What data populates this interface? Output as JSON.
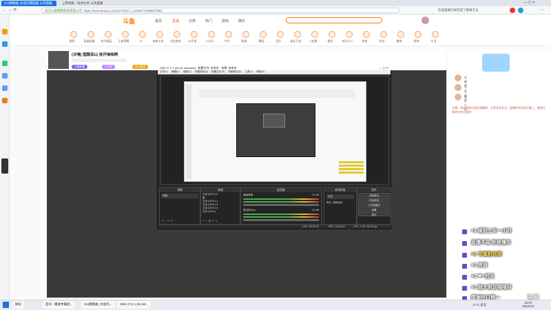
{
  "browser": {
    "tabs": [
      {
        "label": "3v3猜图展_水鱼的猜图展 火热直播",
        "active": true
      },
      {
        "label": "上帝视角 - 技术分享 火热直播",
        "active": false
      }
    ],
    "url": "https://www.douyu.com/4474021?_t=1650771598017581",
    "security_hint": "武汉斗鱼网络科技有限公司",
    "right_promo": "恋城直播已经完成了解锁方法"
  },
  "douyu": {
    "logo": "斗鱼",
    "nav": [
      "首页",
      "直播",
      "分类",
      "热门",
      "游戏",
      "娱乐"
    ],
    "categories": [
      "推荐",
      "英雄联盟",
      "和平精英",
      "王者荣耀",
      "CF",
      "穿越火线",
      "主机游戏",
      "lol手游",
      "二次元",
      "户外",
      "颜值",
      "舞蹈",
      "音乐",
      "娱乐天地",
      "一起看",
      "星秀",
      "快乐小二",
      "体育",
      "科技",
      "美食",
      "原神",
      "生活"
    ],
    "room": {
      "title": "(冷嘿) 国服岳山 技开咱咱咧",
      "tags": [
        "主播直播",
        "生活节",
        "鱼丸赠送"
      ]
    }
  },
  "obs": {
    "title": "OBS 27.2.1 (64-bit, windows) - 配置文件: 未命名 - 场景: 未命名",
    "menu": [
      "文件(F)",
      "编辑(E)",
      "视图(V)",
      "停靠部件(D)",
      "配置文件(P)",
      "场景集合(S)",
      "工具(T)",
      "帮助(H)"
    ],
    "docks": {
      "scenes": "场景",
      "sources": "来源",
      "mixer": "混音器",
      "transitions": "转场特效",
      "controls": "控件"
    },
    "scene_items": [
      "场景"
    ],
    "source_items": [
      "文本 (GDI+) 5",
      "窗",
      "文本 (GDI+) 4",
      "文本 (GDI+) 3",
      "文本 (GDI+) 2",
      "文本 (GDI+)"
    ],
    "mixer_tracks": [
      {
        "name": "桌面音频",
        "db": "0.0 dB"
      },
      {
        "name": "麦克风/Aux",
        "db": "0.0 dB"
      }
    ],
    "transition": {
      "type": "淡出",
      "duration_label": "时长",
      "duration": "300 ms"
    },
    "controls": [
      "开始推流",
      "开始录制",
      "工作室模式",
      "设置",
      "退出"
    ],
    "status": {
      "live": "LIVE: 00:00:00",
      "rec": "REC: 00:00:00",
      "cpu": "CPU: 2.5%, 60.00 fps"
    }
  },
  "sidebar": {
    "rank_rows": [
      "贡献榜",
      "小鱼宝贝",
      "鱼丸小队"
    ],
    "notice": "主播：欢迎来到水鱼的直播间，大家多多关注，直播时间为每天晚上，感谢大家的支持与陪伴！"
  },
  "overlay": [
    {
      "text": "×1 续班上车一小时",
      "highlight": false
    },
    {
      "text": "直播不易 拒绝撸车",
      "highlight": false
    },
    {
      "text": "×1 专属粉丝牌",
      "highlight": true
    },
    {
      "text": "×1 房管",
      "highlight": false
    },
    {
      "text": "×1 ❤+包天",
      "highlight": false
    },
    {
      "text": "×1 我大哥说嘻嘻呀",
      "highlight": false
    },
    {
      "text": "感谢咋日榜一",
      "highlight": false
    }
  ],
  "overlay_name": "洛哥",
  "taskbar": {
    "items": [
      "微信",
      "首页 - 播放中最后...",
      "3v3猜图展_水鱼的...",
      "OBS 27.2.1 (64-bit..."
    ],
    "weather": "17°C 多云",
    "time": "22:07",
    "date": "2022/1/4"
  }
}
